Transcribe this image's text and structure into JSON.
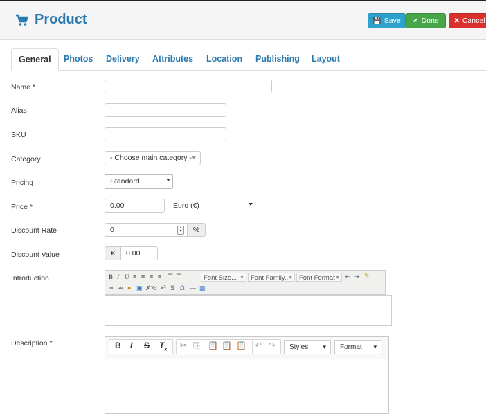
{
  "header": {
    "title": "Product",
    "save_label": "Save",
    "done_label": "Done",
    "cancel_label": "Cancel"
  },
  "tabs": [
    {
      "label": "General"
    },
    {
      "label": "Photos"
    },
    {
      "label": "Delivery"
    },
    {
      "label": "Attributes"
    },
    {
      "label": "Location"
    },
    {
      "label": "Publishing"
    },
    {
      "label": "Layout"
    }
  ],
  "form": {
    "name_label": "Name *",
    "alias_label": "Alias",
    "sku_label": "SKU",
    "category_label": "Category",
    "category_value": "- Choose main category -",
    "pricing_label": "Pricing",
    "pricing_value": "Standard",
    "price_label": "Price *",
    "price_value": "0.00",
    "currency_value": "Euro (€)",
    "discount_rate_label": "Discount Rate",
    "discount_rate_value": "0",
    "discount_rate_unit": "%",
    "discount_value_label": "Discount Value",
    "discount_value_symbol": "€",
    "discount_value_value": "0.00",
    "introduction_label": "Introduction",
    "description_label": "Description *"
  },
  "editor1": {
    "font_size": "Font Size...",
    "font_family": "Font Family..",
    "font_format": "Font Format"
  },
  "editor2": {
    "styles": "Styles",
    "format": "Format"
  },
  "colors": {
    "accent": "#2a7ab0",
    "save": "#2ea2cc",
    "done": "#46a546",
    "cancel": "#d9302c"
  }
}
